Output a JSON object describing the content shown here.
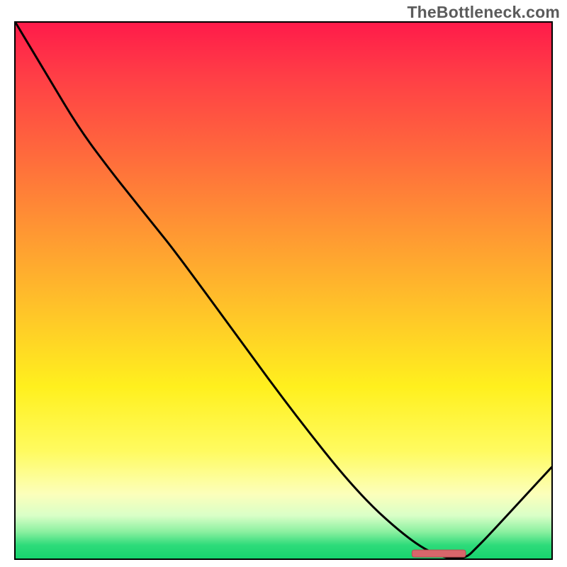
{
  "watermark": "TheBottleneck.com",
  "chart_data": {
    "type": "line",
    "x": [
      0.0,
      0.06,
      0.12,
      0.18,
      0.22,
      0.26,
      0.3,
      0.41,
      0.52,
      0.64,
      0.74,
      0.8,
      0.84,
      0.86,
      0.88,
      1.0
    ],
    "values": [
      100,
      90,
      80,
      72,
      67,
      62,
      57,
      42,
      27,
      12,
      3,
      0,
      0,
      2,
      4,
      17
    ],
    "xlim": [
      0,
      1
    ],
    "ylim": [
      0,
      100
    ],
    "xlabel": "",
    "ylabel": "",
    "title": "",
    "optimum_band": {
      "x_start": 0.74,
      "x_end": 0.84
    },
    "gradient_stops": [
      {
        "pct": 0,
        "color": "#ff1b4a"
      },
      {
        "pct": 10,
        "color": "#ff3e46"
      },
      {
        "pct": 25,
        "color": "#ff6b3c"
      },
      {
        "pct": 40,
        "color": "#ff9a32"
      },
      {
        "pct": 55,
        "color": "#ffc828"
      },
      {
        "pct": 68,
        "color": "#fff01e"
      },
      {
        "pct": 80,
        "color": "#fffb60"
      },
      {
        "pct": 88,
        "color": "#fcffbb"
      },
      {
        "pct": 92,
        "color": "#d9ffc7"
      },
      {
        "pct": 95,
        "color": "#8bf0a0"
      },
      {
        "pct": 97.5,
        "color": "#2edb7a"
      },
      {
        "pct": 100,
        "color": "#17d36e"
      }
    ],
    "curve_color": "#000000",
    "optimum_marker_color": "#d8666b"
  }
}
